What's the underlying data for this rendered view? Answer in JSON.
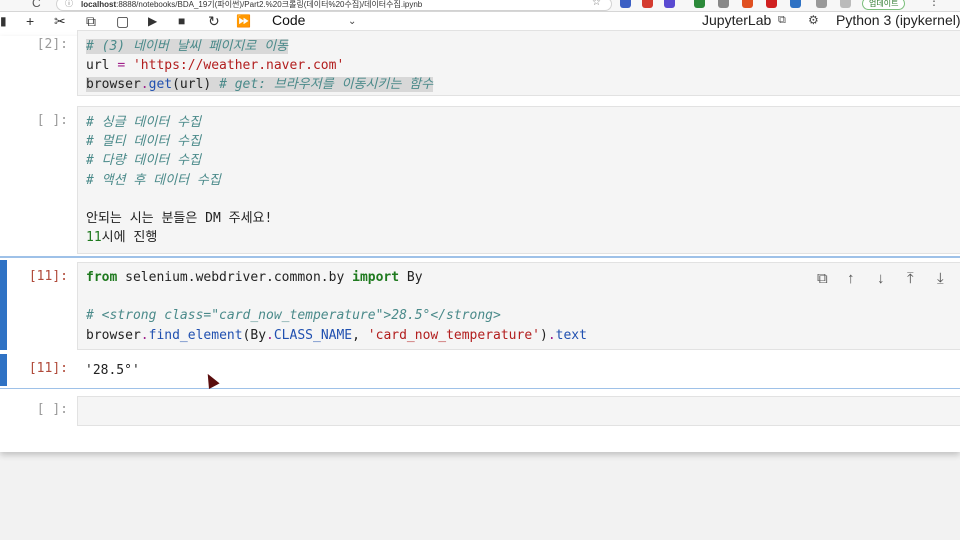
{
  "browser": {
    "url_host": "localhost",
    "url_rest": ":8888/notebooks/BDA_19기(파이썬)/Part2.%20크롤링(데이터%20수집)/데이터수집.ipynb",
    "update_label": "업데이트",
    "nav_glyph": "C",
    "info_glyph": "ⓘ",
    "star_glyph": "☆",
    "more_glyph": "⋮"
  },
  "toolbar": {
    "cell_type": "Code",
    "caret": "⌄",
    "kernel_name": "JupyterLab",
    "kernel_spec": "Python 3 (ipykernel)",
    "icons": {
      "add": "+",
      "cut": "✂",
      "copy": "⧉",
      "paste": "▢",
      "run": "▶",
      "stop": "■",
      "restart": "↻",
      "run_all": "⏩",
      "kernel_status": "◔",
      "settings": "⚙"
    }
  },
  "cells": [
    {
      "prompt": "[2]:",
      "lines": [
        "# (3) 네이버 날씨 페이지로 이동",
        "url = 'https://weather.naver.com'",
        "browser.get(url) # get: 브라우저를 이동시키는 함수"
      ]
    },
    {
      "prompt": "[ ]:",
      "lines": [
        "# 싱글 데이터 수집",
        "# 멀티 데이터 수집",
        "# 다량 데이터 수집",
        "# 액션 후 데이터 수집",
        "",
        "안되는 시는 분들은 DM 주세요!",
        "11시에 진행"
      ]
    },
    {
      "prompt": "[11]:",
      "lines": [
        "from selenium.webdriver.common.by import By",
        "",
        "# <strong class=\"card_now_temperature\">28.5°</strong>",
        "browser.find_element(By.CLASS_NAME, 'card_now_temperature').text"
      ],
      "output_prompt": "[11]:",
      "output": "'28.5°'"
    },
    {
      "prompt": "[ ]:",
      "lines": []
    }
  ],
  "cell_toolbar": {
    "duplicate": "⧉",
    "move_up": "↑",
    "move_down": "↓",
    "insert_above": "⤒",
    "insert_below": "⤓"
  },
  "colors": {
    "active_cell": "#2f72c4",
    "comment": "#4a8a8a",
    "string": "#b21e1e",
    "keyword": "#1f7a1f"
  }
}
